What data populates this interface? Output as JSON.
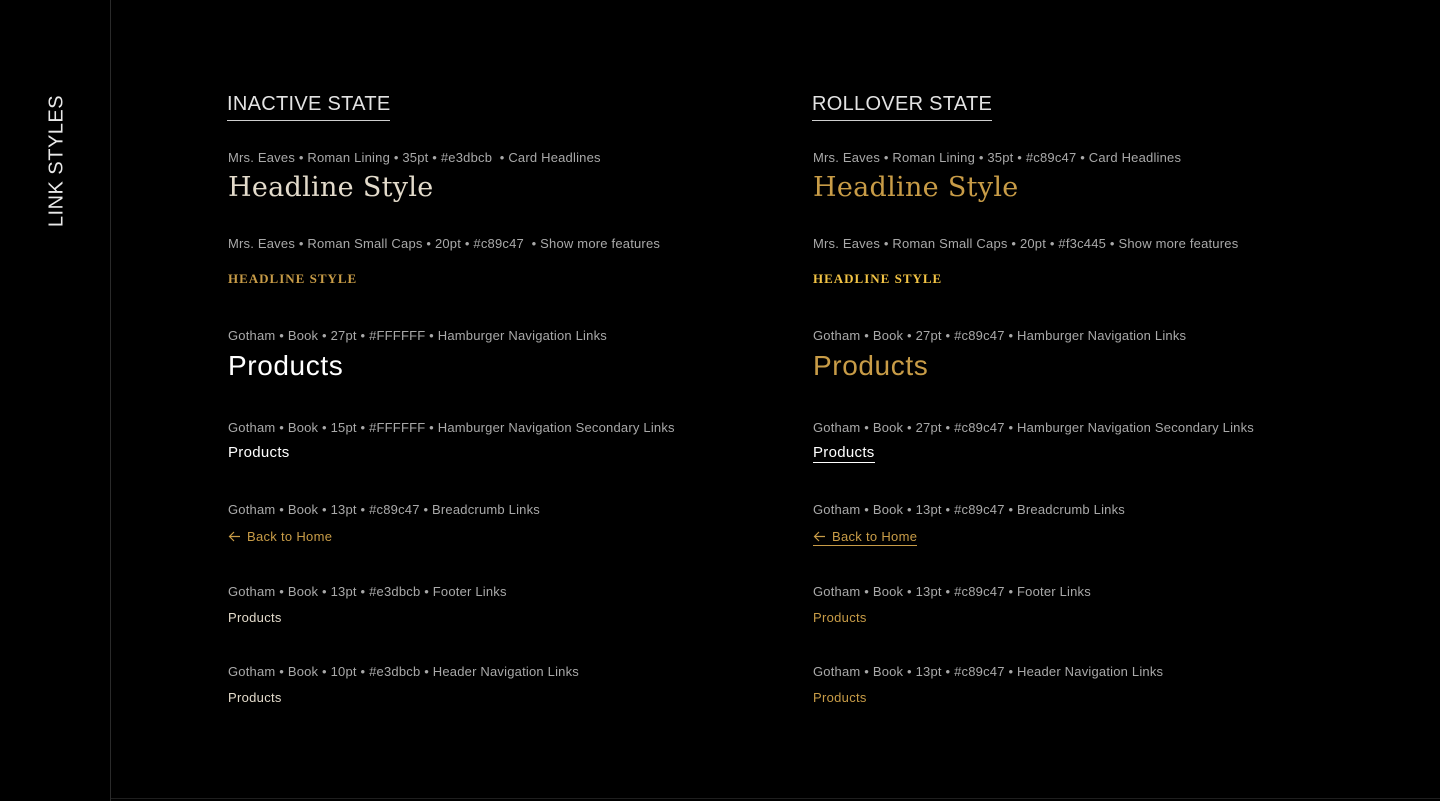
{
  "sidebar": {
    "title": "LINK STYLES"
  },
  "colors": {
    "white": "#FFFFFF",
    "cream": "#e3dbcb",
    "gold": "#c89c47",
    "spec_gray": "#a9a9a9"
  },
  "inactive": {
    "title": "INACTIVE STATE",
    "headline_spec": "Mrs. Eaves • Roman Lining • 35pt • #e3dbcb  • Card Headlines",
    "headline_sample": "Headline Style",
    "smallcaps_spec": "Mrs. Eaves • Roman Small Caps • 20pt • #c89c47  • Show more features",
    "smallcaps_sample": "HEADLINE STYLE",
    "hamburger_spec": "Gotham • Book • 27pt • #FFFFFF • Hamburger Navigation Links",
    "hamburger_sample": "Products",
    "secondary_spec": "Gotham • Book • 15pt • #FFFFFF • Hamburger Navigation Secondary Links",
    "secondary_sample": "Products",
    "breadcrumb_spec": "Gotham • Book • 13pt • #c89c47 • Breadcrumb Links",
    "breadcrumb_sample": "Back to Home",
    "footer_spec": "Gotham • Book • 13pt • #e3dbcb • Footer Links",
    "footer_sample": "Products",
    "header_spec": "Gotham • Book • 10pt • #e3dbcb • Header Navigation Links",
    "header_sample": "Products"
  },
  "rollover": {
    "title": "ROLLOVER STATE",
    "headline_spec": "Mrs. Eaves • Roman Lining • 35pt • #c89c47 • Card Headlines",
    "headline_sample": "Headline Style",
    "smallcaps_spec": "Mrs. Eaves • Roman Small Caps • 20pt • #f3c445 • Show more features",
    "smallcaps_sample": "HEADLINE STYLE",
    "hamburger_spec": "Gotham • Book • 27pt • #c89c47 • Hamburger Navigation Links",
    "hamburger_sample": "Products",
    "secondary_spec": "Gotham • Book • 27pt • #c89c47 • Hamburger Navigation Secondary Links",
    "secondary_sample": "Products",
    "breadcrumb_spec": "Gotham • Book • 13pt • #c89c47 • Breadcrumb Links",
    "breadcrumb_sample": "Back to Home",
    "footer_spec": "Gotham • Book • 13pt • #c89c47 • Footer Links",
    "footer_sample": "Products",
    "header_spec": "Gotham • Book • 13pt • #c89c47 • Header Navigation Links",
    "header_sample": "Products"
  }
}
